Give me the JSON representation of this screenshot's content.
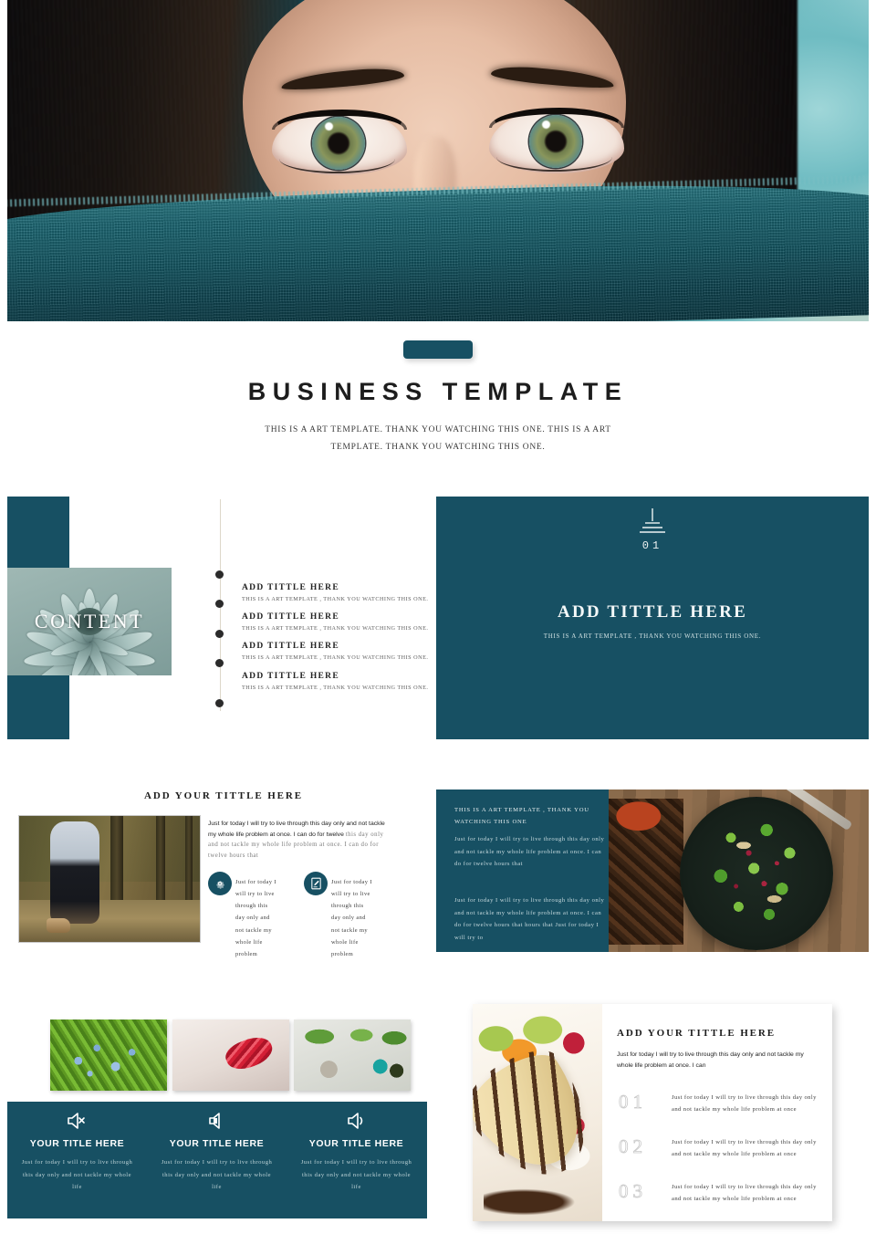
{
  "hero": {
    "alt": "close-up portrait of woman with green eyes behind teal knit scarf"
  },
  "title": {
    "heading": "BUSINESS  TEMPLATE",
    "subtitle": "THIS IS A ART TEMPLATE. THANK YOU WATCHING THIS ONE. THIS IS A ART TEMPLATE. THANK YOU WATCHING THIS ONE."
  },
  "content_section": {
    "photo_label": "CONTENT",
    "items": [
      {
        "title": "ADD TITTLE HERE",
        "desc": "THIS IS A ART TEMPLATE , THANK YOU WATCHING THIS ONE."
      },
      {
        "title": "ADD TITTLE HERE",
        "desc": "THIS IS A ART TEMPLATE , THANK YOU WATCHING THIS ONE."
      },
      {
        "title": "ADD TITTLE HERE",
        "desc": "THIS IS A ART TEMPLATE , THANK YOU WATCHING THIS ONE."
      },
      {
        "title": "ADD TITTLE HERE",
        "desc": "THIS IS A ART TEMPLATE , THANK YOU WATCHING THIS ONE."
      }
    ],
    "panel": {
      "icon": "lamp-icon",
      "number": "01",
      "title": "ADD TITTLE HERE",
      "subtitle": "THIS IS A ART TEMPLATE ,  THANK YOU WATCHING THIS ONE."
    }
  },
  "feature_section": {
    "title": "ADD YOUR TITTLE   HERE",
    "lead_bold": "Just for today I will try to live through this day only and not tackle my whole life problem at once. I can do for twelve ",
    "lead_faded": "this day only and not tackle my whole life problem at once. I can do for twelve hours that",
    "features": [
      {
        "icon": "gear-icon",
        "text": "Just for today I will try to live through this day only and not tackle my whole life problem"
      },
      {
        "icon": "document-edit-icon",
        "text": "Just for today I will try to live through this day only and not tackle my whole life problem"
      }
    ],
    "panel": {
      "heading": "THIS IS A ART TEMPLATE , THANK YOU WATCHING THIS ONE",
      "paragraph1": "Just for today I will try to live through this day only and not tackle my whole life problem at once. I can do for twelve hours that",
      "paragraph2": "Just for today I will try to live through this day only and not tackle my whole life problem at once. I can do for twelve hours that hours that Just for today I will try to"
    },
    "food_image_alt": "salad bowl with spinach pomegranate and chicken"
  },
  "cards_section": {
    "thumbnails": [
      {
        "alt": "blue juniper berries on green branch"
      },
      {
        "alt": "red lipstick on pale hair"
      },
      {
        "alt": "potted succulents and plants from above"
      }
    ],
    "cards": [
      {
        "icon": "volume-mute-icon",
        "title": "YOUR TITLE HERE",
        "desc": "Just for today I will try to live through this day only and not tackle my whole life"
      },
      {
        "icon": "volume-low-icon",
        "title": "YOUR TITLE HERE",
        "desc": "Just for today I will try to live through this day only and not tackle my whole life"
      },
      {
        "icon": "volume-medium-icon",
        "title": "YOUR TITLE HERE",
        "desc": "Just for today I will try to live through this day only and not tackle my whole life"
      }
    ]
  },
  "list_section": {
    "photo_alt": "banana dessert with chocolate sauce and whipped cream",
    "title": "ADD YOUR TITTLE   HERE",
    "lead": "Just for today I will try to live through this day only and not tackle my whole life problem at once. I can",
    "rows": [
      {
        "number": "01",
        "text": "Just for today I will try to live through this day only and not tackle my whole life problem at once"
      },
      {
        "number": "02",
        "text": "Just for today I will try to live through this day only and not tackle my whole life problem at once"
      },
      {
        "number": "03",
        "text": "Just for today I will try to live through this day only and not tackle my whole life problem at once"
      }
    ]
  },
  "colors": {
    "teal": "#175063",
    "panel_text": "#cfe0e2",
    "number_outline": "#c9c9c9"
  }
}
